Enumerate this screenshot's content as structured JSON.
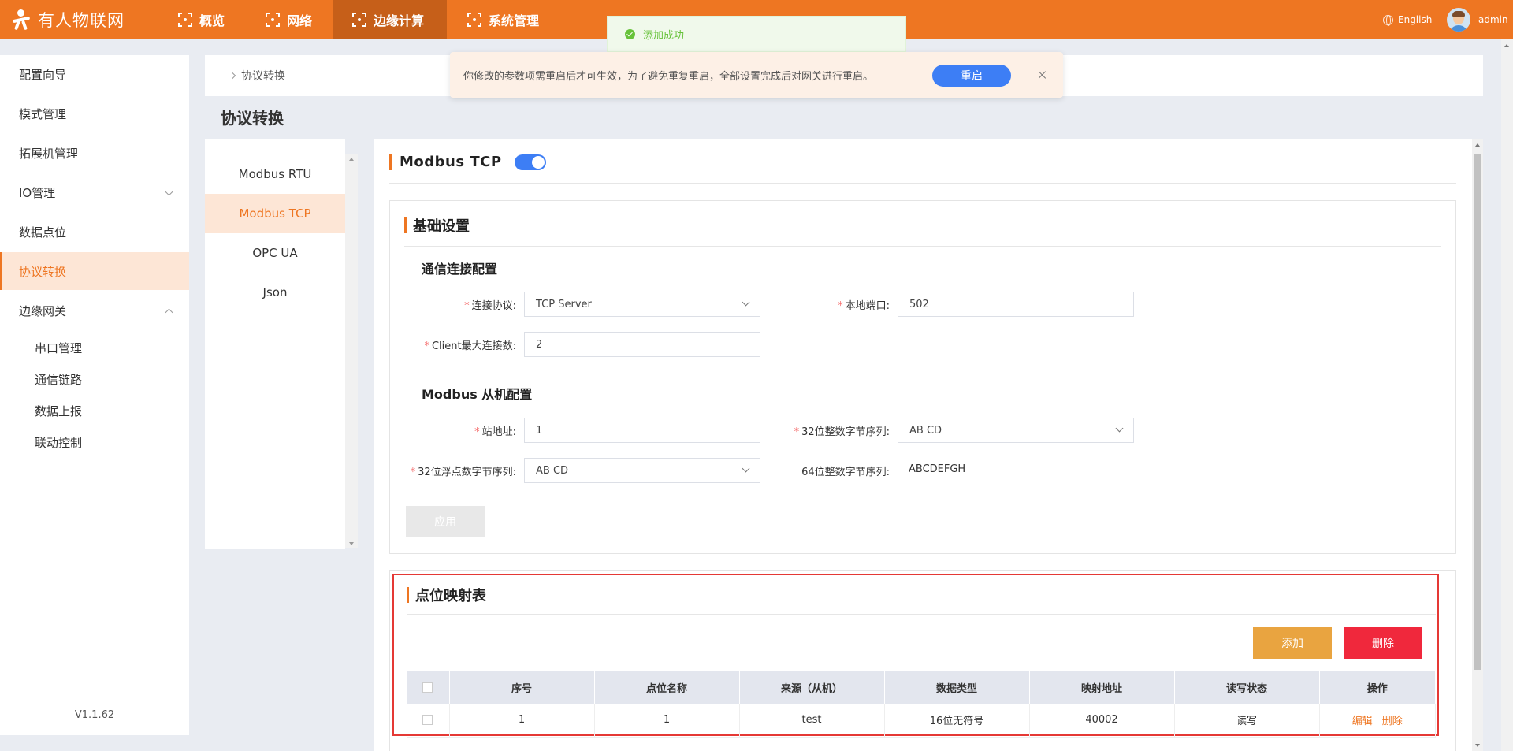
{
  "app": {
    "brand": "有人物联网",
    "version": "V1.1.62"
  },
  "topnav": {
    "items": [
      {
        "label": "概览"
      },
      {
        "label": "网络"
      },
      {
        "label": "边缘计算"
      },
      {
        "label": "系统管理"
      }
    ],
    "active": "边缘计算",
    "language": "English",
    "user": "admin"
  },
  "sidebar": {
    "items": [
      {
        "label": "配置向导"
      },
      {
        "label": "模式管理"
      },
      {
        "label": "拓展机管理"
      },
      {
        "label": "IO管理"
      },
      {
        "label": "数据点位"
      },
      {
        "label": "协议转换"
      },
      {
        "label": "边缘网关"
      }
    ],
    "sub_items": [
      {
        "label": "串口管理"
      },
      {
        "label": "通信链路"
      },
      {
        "label": "数据上报"
      },
      {
        "label": "联动控制"
      }
    ],
    "active": "协议转换"
  },
  "breadcrumb": {
    "current": "协议转换"
  },
  "page": {
    "title": "协议转换"
  },
  "protocols": {
    "items": [
      {
        "label": "Modbus RTU"
      },
      {
        "label": "Modbus TCP"
      },
      {
        "label": "OPC UA"
      },
      {
        "label": "Json"
      }
    ],
    "active": "Modbus TCP"
  },
  "modbus_tcp": {
    "title": "Modbus TCP",
    "enabled": true,
    "basic": {
      "title": "基础设置",
      "conn_section": "通信连接配置",
      "protocol_label": "连接协议:",
      "protocol_value": "TCP Server",
      "port_label": "本地端口:",
      "port_value": "502",
      "max_client_label": "Client最大连接数:",
      "max_client_value": "2",
      "slave_section": "Modbus 从机配置",
      "station_label": "站地址:",
      "station_value": "1",
      "int32_label": "32位整数字节序列:",
      "int32_value": "AB CD",
      "float32_label": "32位浮点数字节序列:",
      "float32_value": "AB CD",
      "int64_label": "64位整数字节序列:",
      "int64_value": "ABCDEFGH",
      "apply_label": "应用"
    },
    "mapping": {
      "title": "点位映射表",
      "add_label": "添加",
      "delete_label": "删除",
      "columns": [
        "序号",
        "点位名称",
        "来源（从机）",
        "数据类型",
        "映射地址",
        "读写状态",
        "操作"
      ],
      "rows": [
        {
          "index": "1",
          "name": "1",
          "source": "test",
          "type": "16位无符号",
          "address": "40002",
          "rw": "读写",
          "edit": "编辑",
          "del": "删除"
        }
      ]
    }
  },
  "toasts": {
    "success": "添加成功",
    "warning": "你修改的参数项需重启后才可生效，为了避免重复重启，全部设置完成后对网关进行重启。",
    "restart_label": "重启"
  },
  "colors": {
    "brand": "#ee7622",
    "accent": "#3d7ef5",
    "danger": "#f0283c",
    "warning_btn": "#e9a440"
  }
}
